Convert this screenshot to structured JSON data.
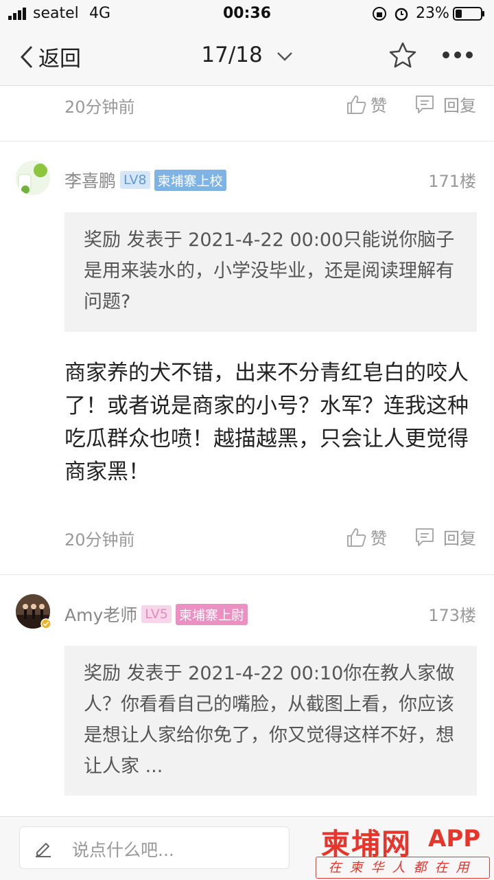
{
  "status_bar": {
    "carrier": "seatel",
    "network": "4G",
    "time": "00:36",
    "battery": "23%"
  },
  "nav": {
    "back_label": "返回",
    "page_indicator": "17/18"
  },
  "top_item": {
    "time": "20分钟前",
    "like_label": "赞",
    "reply_label": "回复"
  },
  "posts": [
    {
      "username": "李喜鹏",
      "level": "LV8",
      "rank": "柬埔寨上校",
      "floor": "171楼",
      "quote": "奖励 发表于 2021-4-22 00:00只能说你脑子是用来装水的，小学没毕业，还是阅读理解有问题?",
      "body": "商家养的犬不错，出来不分青红皂白的咬人了！或者说是商家的小号？水军？连我这种吃瓜群众也喷！越描越黑，只会让人更觉得商家黑！",
      "time": "20分钟前",
      "like_label": "赞",
      "reply_label": "回复"
    },
    {
      "username": "Amy老师",
      "level": "LV5",
      "rank": "柬埔寨上尉",
      "floor": "173楼",
      "quote": "奖励 发表于 2021-4-22 00:10你在教人家做人？你看看自己的嘴脸，从截图上看，你应该是想让人家给你免了，你又觉得这样不好，想让人家 ..."
    }
  ],
  "bottom": {
    "input_placeholder": "说点什么吧...",
    "watermark_main": "柬埔网",
    "watermark_app": "APP",
    "watermark_slogan": "在柬华人都在用"
  },
  "colors": {
    "level_blue": "#5b9bd5",
    "rank_blue": "#6aa9e0",
    "level_pink": "#f0a0c8",
    "rank_pink": "#e87fb8",
    "watermark_red": "#e8352c"
  },
  "icons": [
    "signal-icon",
    "lock-rotation-icon",
    "alarm-icon",
    "battery-icon",
    "back-chevron-icon",
    "chevron-down-icon",
    "star-icon",
    "more-icon",
    "like-icon",
    "comment-icon",
    "edit-icon"
  ]
}
